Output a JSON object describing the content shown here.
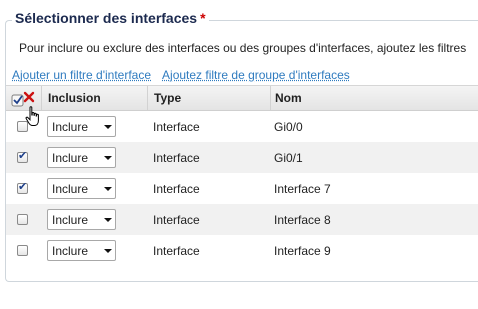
{
  "section": {
    "title": "Sélectionner des interfaces",
    "required_mark": "*",
    "intro": "Pour inclure ou exclure des interfaces ou des groupes d'interfaces, ajoutez les filtres"
  },
  "links": {
    "add_interface_filter": "Ajouter un filtre d'interface",
    "add_group_filter": "Ajoutez filtre de groupe d'interfaces"
  },
  "table": {
    "headers": {
      "inclusion": "Inclusion",
      "type": "Type",
      "name": "Nom"
    },
    "select_all_icon": "select-all-clear-icon",
    "rows": [
      {
        "checked": false,
        "inclusion": "Inclure",
        "type": "Interface",
        "name": "Gi0/0"
      },
      {
        "checked": true,
        "inclusion": "Inclure",
        "type": "Interface",
        "name": "Gi0/1"
      },
      {
        "checked": true,
        "inclusion": "Inclure",
        "type": "Interface",
        "name": "Interface 7"
      },
      {
        "checked": false,
        "inclusion": "Inclure",
        "type": "Interface",
        "name": "Interface 8"
      },
      {
        "checked": false,
        "inclusion": "Inclure",
        "type": "Interface",
        "name": "Interface 9"
      }
    ]
  },
  "colors": {
    "title": "#1c2a4f",
    "required": "#cc0000",
    "link": "#2f7bbf",
    "alt_row": "#f1f1f1",
    "check": "#1d3f8a"
  }
}
